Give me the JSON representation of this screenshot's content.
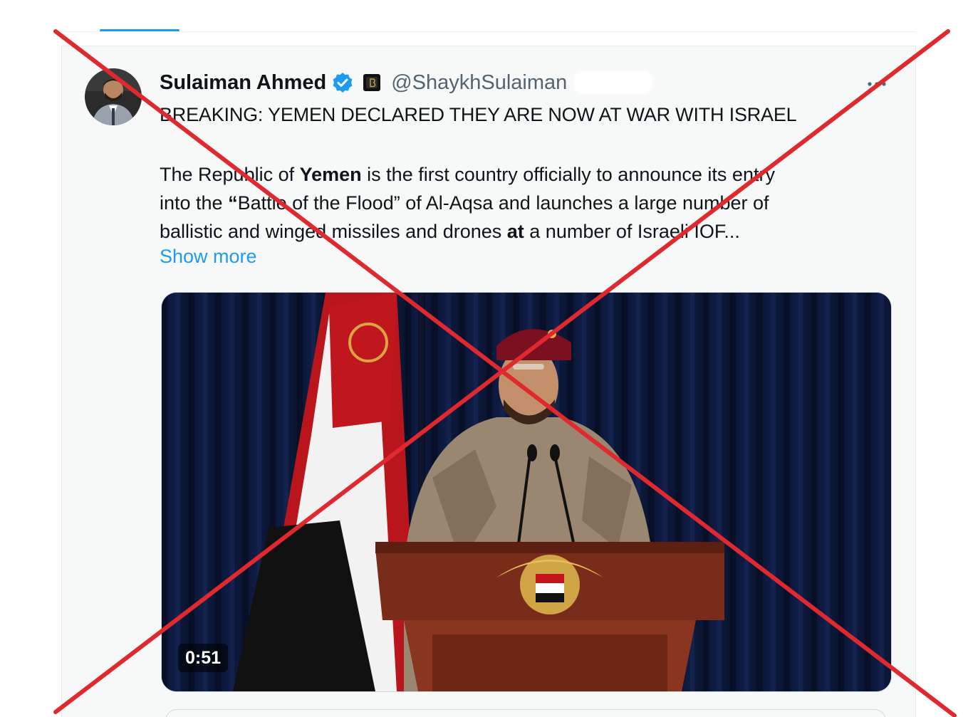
{
  "tweet": {
    "author_name": "Sulaiman Ahmed",
    "handle": "@ShaykhSulaiman",
    "headline": "BREAKING: YEMEN DECLARED THEY ARE NOW AT WAR WITH ISRAEL",
    "body": {
      "line1_a": "The Republic of ",
      "line1_bold": "Yemen",
      "line1_b": " is the first country officially to announce its entry",
      "line2_a": "into the ",
      "line2_bold": "“",
      "line2_b": "Battle of the Flood” of Al-Aqsa and launches a large number of",
      "line3_a": "ballistic and winged missiles and drones ",
      "line3_bold": "at",
      "line3_b": " a number of Israeli IOF..."
    },
    "show_more": "Show more",
    "video_duration": "0:51"
  },
  "icons": {
    "verified": "verified-badge-icon",
    "affiliate": "affiliate-badge-icon",
    "more": "more-options-icon"
  },
  "colors": {
    "accent": "#1d9bf0",
    "text": "#0f1419",
    "muted": "#536471",
    "cross": "#e0282f"
  }
}
